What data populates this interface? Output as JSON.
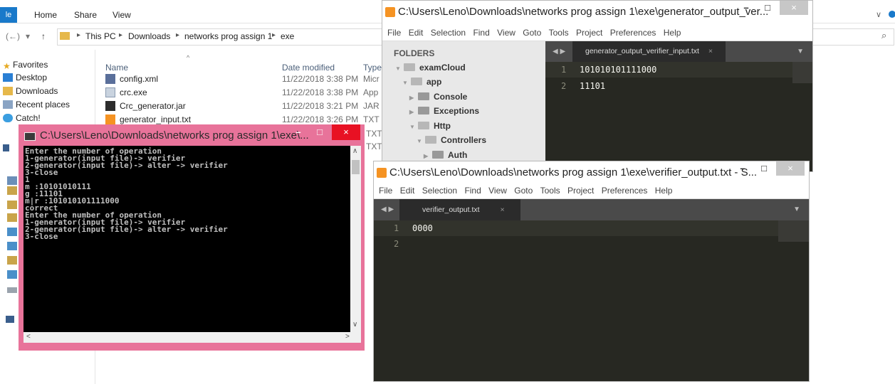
{
  "explorer": {
    "ribbon_tabs": [
      "Home",
      "Share",
      "View"
    ],
    "ribbon_file_label": "le",
    "path": [
      "This PC",
      "Downloads",
      "networks prog assign 1",
      "exe"
    ],
    "nav_back": "(←)",
    "nav_fwd": "→",
    "nav_recent": "▾",
    "nav_up": "↑",
    "search_icon": "⌕",
    "nav_items": [
      {
        "label": "Favorites",
        "icon": "star-icon"
      },
      {
        "label": "Desktop",
        "icon": "desktop-icon"
      },
      {
        "label": "Downloads",
        "icon": "downloads-icon"
      },
      {
        "label": "Recent places",
        "icon": "recent-icon"
      },
      {
        "label": "Catch!",
        "icon": "catch-icon"
      }
    ],
    "columns": [
      "Name",
      "Date modified",
      "Type"
    ],
    "files": [
      {
        "name": "config.xml",
        "date": "11/22/2018 3:38 PM",
        "type": "Micr",
        "icon": "xml-icon"
      },
      {
        "name": "crc.exe",
        "date": "11/22/2018 3:38 PM",
        "type": "App",
        "icon": "exe-icon"
      },
      {
        "name": "Crc_generator.jar",
        "date": "11/22/2018 3:21 PM",
        "type": "JAR",
        "icon": "jar-icon"
      },
      {
        "name": "generator_input.txt",
        "date": "11/22/2018 3:26 PM",
        "type": "TXT",
        "icon": "sublime-file-icon"
      }
    ],
    "hidden_types": [
      "TXT",
      "TXT"
    ]
  },
  "sublime1": {
    "title": "C:\\Users\\Leno\\Downloads\\networks prog assign 1\\exe\\generator_output_ver...",
    "menu": [
      "File",
      "Edit",
      "Selection",
      "Find",
      "View",
      "Goto",
      "Tools",
      "Project",
      "Preferences",
      "Help"
    ],
    "folders_label": "FOLDERS",
    "tree": [
      "examCloud",
      "app",
      "Console",
      "Exceptions",
      "Http",
      "Controllers",
      "Auth"
    ],
    "tab_label": "generator_output_verifier_input.txt",
    "tab_close": "×",
    "lines": [
      "101010101111000",
      "11101"
    ],
    "line_numbers": [
      "1",
      "2"
    ]
  },
  "sublime2": {
    "title": "C:\\Users\\Leno\\Downloads\\networks prog assign 1\\exe\\verifier_output.txt - S...",
    "menu": [
      "File",
      "Edit",
      "Selection",
      "Find",
      "View",
      "Goto",
      "Tools",
      "Project",
      "Preferences",
      "Help"
    ],
    "tab_label": "verifier_output.txt",
    "tab_close": "×",
    "lines": [
      "0000",
      ""
    ],
    "line_numbers": [
      "1",
      "2"
    ]
  },
  "cmd": {
    "title": "C:\\Users\\Leno\\Downloads\\networks prog assign 1\\exe\\...",
    "output": [
      "Enter the number of operation",
      "1-generator(input file)-> verifier",
      "2-generator(input file)-> alter -> verifier",
      "3-close",
      "1",
      "m :10101010111",
      "g :11101",
      "m|r :101010101111000",
      "correct",
      "Enter the number of operation",
      "1-generator(input file)-> verifier",
      "2-generator(input file)-> alter -> verifier",
      "3-close"
    ]
  },
  "window_controls": {
    "minimize": "–",
    "maximize": "□",
    "close": "×"
  },
  "colors": {
    "cmd_frame": "#e8739a",
    "sublime_bg": "#272822",
    "sublime_accent": "#f59323"
  }
}
